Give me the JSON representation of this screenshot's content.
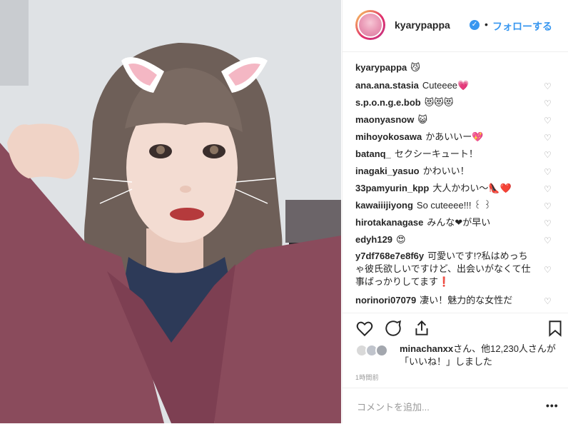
{
  "post": {
    "author": "kyarypappa",
    "follow_label": "フォローする",
    "separator": "•"
  },
  "comments": [
    {
      "user": "kyarypappa",
      "text": "😼"
    },
    {
      "user": "ana.ana.stasia",
      "text": "Cuteeee💗"
    },
    {
      "user": "s.p.o.n.g.e.bob",
      "text": "😻😻😻"
    },
    {
      "user": "maonyasnow",
      "text": "😺"
    },
    {
      "user": "mihoyokosawa",
      "text": "かあいいー💖"
    },
    {
      "user": "batanq_",
      "text": "セクシーキュート！"
    },
    {
      "user": "inagaki_yasuo",
      "text": "かわいい！"
    },
    {
      "user": "33pamyurin_kpp",
      "text": "大人かわい〜👠❤️"
    },
    {
      "user": "kawaiiijiyong",
      "text": "So cuteeee!!! ꒰ ꒱"
    },
    {
      "user": "hirotakanagase",
      "text": "みんな❤が早い"
    },
    {
      "user": "edyh129",
      "text": "😍"
    },
    {
      "user": "y7df768e7e8f6y",
      "text": "可愛いです!?私はめっちゃ彼氏欲しいですけど、出会いがなくて仕事ばっかりしてます❗"
    },
    {
      "user": "norinori07079",
      "text": "凄い！魅力的な女性だ"
    }
  ],
  "likes": {
    "user": "minachanxx",
    "text": "さん、他12,230人さんが「いいね！」しました"
  },
  "time_ago": "1時間前",
  "comment_input": {
    "placeholder": "コメントを追加...",
    "more": "•••"
  },
  "colors": {
    "accent": "#3897f0",
    "text": "#262626",
    "muted": "#999999",
    "border": "#efefef"
  },
  "icons": [
    "verified-badge-icon",
    "heart-icon",
    "comment-icon",
    "share-icon",
    "bookmark-icon"
  ]
}
